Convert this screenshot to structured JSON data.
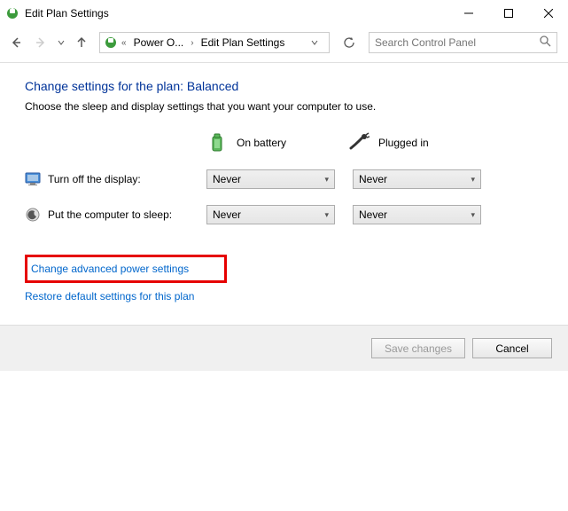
{
  "titlebar": {
    "text": "Edit Plan Settings"
  },
  "breadcrumb": {
    "seg1": "Power O...",
    "seg2": "Edit Plan Settings"
  },
  "search": {
    "placeholder": "Search Control Panel"
  },
  "heading": "Change settings for the plan: Balanced",
  "subtext": "Choose the sleep and display settings that you want your computer to use.",
  "modes": {
    "battery": "On battery",
    "plugged": "Plugged in"
  },
  "settings": {
    "display": {
      "label": "Turn off the display:",
      "battery": "Never",
      "plugged": "Never"
    },
    "sleep": {
      "label": "Put the computer to sleep:",
      "battery": "Never",
      "plugged": "Never"
    }
  },
  "links": {
    "advanced": "Change advanced power settings",
    "restore": "Restore default settings for this plan"
  },
  "buttons": {
    "save": "Save changes",
    "cancel": "Cancel"
  }
}
